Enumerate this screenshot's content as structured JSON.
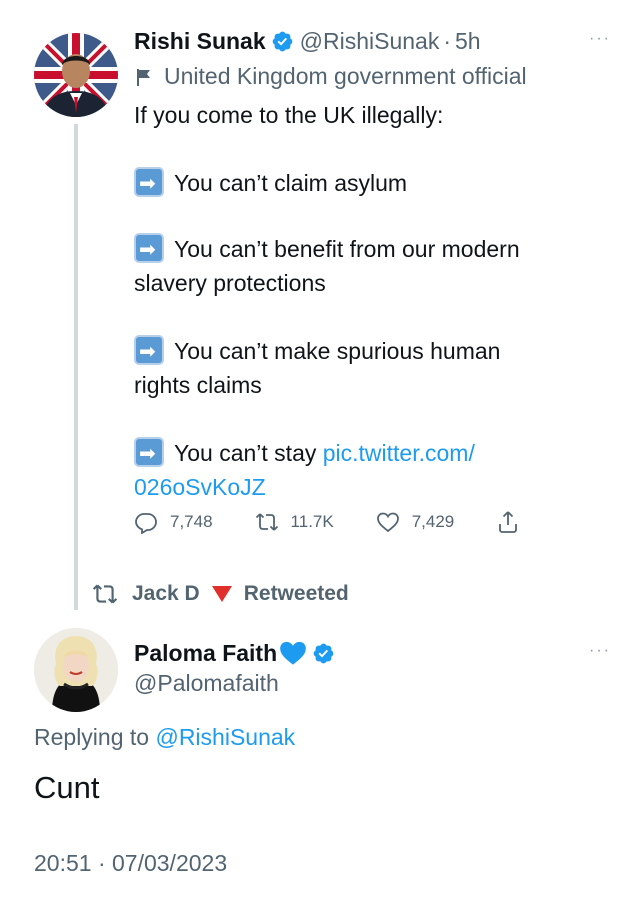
{
  "tweet": {
    "author_name": "Rishi Sunak",
    "author_handle": "@RishiSunak",
    "dot": "·",
    "time": "5h",
    "more": "···",
    "account_label": "United Kingdom government official",
    "body": {
      "line1": "If you come to the UK illegally:",
      "line2": "You can’t claim asylum",
      "line3a": "You can’t benefit from our modern",
      "line3b": "slavery protections",
      "line4a": "You can’t make spurious human",
      "line4b": "rights claims",
      "line5a": "You can’t stay ",
      "link_part1": "pic.twitter.com/",
      "link_part2": "026oSvKoJZ"
    },
    "arrow_icon": "right-arrow-emoji",
    "stats": {
      "replies": "7,748",
      "retweets": "11.7K",
      "likes": "7,429"
    }
  },
  "retweet_notice": {
    "user": "Jack D",
    "text": "Retweeted"
  },
  "reply": {
    "author_name": "Paloma Faith",
    "author_handle": "@Palomafaith",
    "more": "···",
    "replying_prefix": "Replying to ",
    "replying_to": "@RishiSunak",
    "text": "Cunt",
    "timestamp": "20:51 · 07/03/2023"
  },
  "colors": {
    "link": "#1d9bf0",
    "secondary_text": "#536471",
    "verified": "#1d9bf0",
    "heart": "#1d9bf0",
    "flag": "#e0302b"
  }
}
